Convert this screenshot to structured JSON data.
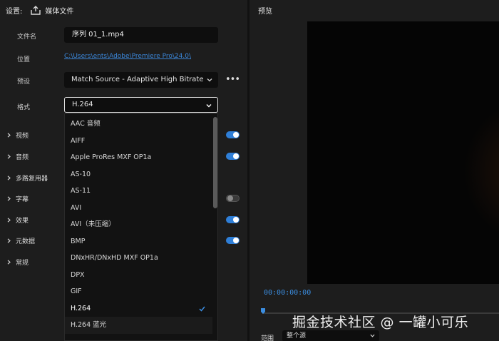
{
  "header": {
    "settings_label": "设置:",
    "media_label": "媒体文件"
  },
  "fields": {
    "filename_label": "文件名",
    "filename_value": "序列 01_1.mp4",
    "location_label": "位置",
    "location_value": "C:\\Users\\ents\\Adobe\\Premiere Pro\\24.0\\",
    "preset_label": "预设",
    "preset_value": "Match Source - Adaptive High Bitrate",
    "format_label": "格式",
    "format_value": "H.264",
    "more_label": "•••"
  },
  "sections": [
    {
      "label": "视频",
      "toggle": "on"
    },
    {
      "label": "音频",
      "toggle": "on"
    },
    {
      "label": "多路复用器",
      "toggle": "none"
    },
    {
      "label": "字幕",
      "toggle": "off"
    },
    {
      "label": "效果",
      "toggle": "on"
    },
    {
      "label": "元数据",
      "toggle": "on"
    },
    {
      "label": "常规",
      "toggle": "none"
    }
  ],
  "format_options": [
    "AAC 音频",
    "AIFF",
    "Apple ProRes MXF OP1a",
    "AS-10",
    "AS-11",
    "AVI",
    "AVI（未压缩）",
    "BMP",
    "DNxHR/DNxHD MXF OP1a",
    "DPX",
    "GIF",
    "H.264",
    "H.264 蓝光"
  ],
  "format_selected": "H.264",
  "preview": {
    "title": "预览",
    "timecode": "00:00:00:00",
    "range_label": "范围",
    "range_value": "整个源"
  },
  "watermark": "掘金技术社区 @ 一罐小可乐",
  "colors": {
    "accent": "#2f7fd8",
    "link": "#3b86d8",
    "timecode": "#3b8de0",
    "panel_bg": "#1d1d1d",
    "input_bg": "#0e0e0e"
  }
}
